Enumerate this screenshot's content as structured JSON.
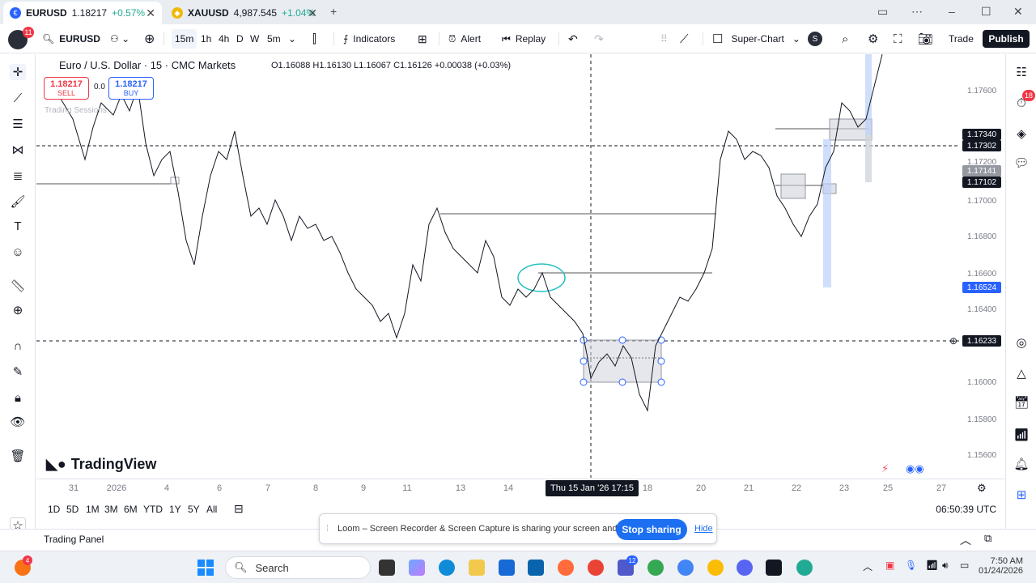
{
  "browser": {
    "tab1": {
      "symbol": "EURUSD",
      "price": "1.18217",
      "change": "+0.57%"
    },
    "tab2": {
      "symbol": "XAUUSD",
      "price": "4,987.545",
      "change": "+1.04%"
    },
    "new_tab": "+"
  },
  "toolbar": {
    "avatar_badge": "11",
    "symbol": "EURUSD",
    "intervals": [
      "15m",
      "1h",
      "4h",
      "D",
      "W",
      "5m"
    ],
    "indicators_label": "Indicators",
    "alert_label": "Alert",
    "replay_label": "Replay",
    "layout_label": "Super-Chart",
    "layout_badge": "S",
    "trade_label": "Trade",
    "publish_label": "Publish"
  },
  "chart": {
    "title": "Euro / U.S. Dollar · 15 · CMC Markets",
    "ohlc": "O1.16088 H1.16130 L1.16067 C1.16126 +0.00038 (+0.03%)",
    "sell": {
      "value": "1.18217",
      "label": "SELL"
    },
    "buy": {
      "value": "1.18217",
      "label": "BUY"
    },
    "spread": "0.0",
    "sessions_label": "Trading Sessions",
    "watermark": "TradingView",
    "price_axis": [
      "1.17600",
      "1.17200",
      "1.17000",
      "1.16800",
      "1.16600",
      "1.16400",
      "1.16000",
      "1.15800",
      "1.15600"
    ],
    "price_tags": [
      {
        "value": "1.17340",
        "color": "#131722"
      },
      {
        "value": "1.17302",
        "color": "#131722"
      },
      {
        "value": "1.17141",
        "color": "#9598a1"
      },
      {
        "value": "1.17102",
        "color": "#131722"
      },
      {
        "value": "1.16524",
        "color": "#2962ff"
      },
      {
        "value": "1.16233",
        "color": "#131722"
      }
    ],
    "time_axis": [
      "31",
      "2026",
      "4",
      "6",
      "7",
      "8",
      "9",
      "11",
      "13",
      "14",
      "18",
      "20",
      "21",
      "22",
      "23",
      "25",
      "27"
    ],
    "cursor_time": "Thu 15 Jan '26   17:15"
  },
  "rangebar": {
    "ranges": [
      "1D",
      "5D",
      "1M",
      "3M",
      "6M",
      "YTD",
      "1Y",
      "5Y",
      "All"
    ],
    "clock": "06:50:39 UTC"
  },
  "trading_panel_label": "Trading Panel",
  "right_badge": "18",
  "loom": {
    "message": "Loom – Screen Recorder & Screen Capture is sharing your screen and audio.",
    "stop_label": "Stop sharing",
    "hide_label": "Hide"
  },
  "taskbar": {
    "search_label": "Search",
    "time": "7:50 AM",
    "date": "01/24/2026",
    "notif_badge": "4",
    "teams_badge": "12"
  }
}
